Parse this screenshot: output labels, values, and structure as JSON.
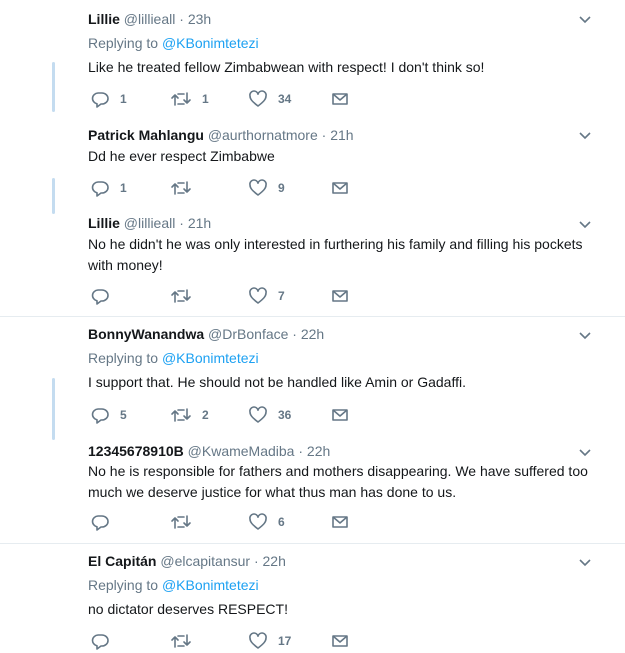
{
  "tweets": [
    {
      "name": "Lillie",
      "handle": "@lillieall",
      "dot": "·",
      "time": "23h",
      "replying_prefix": "Replying to ",
      "replying_handle": "@KBonimtetezi",
      "text": "Like he treated fellow Zimbabwean with respect! I don't think so!",
      "replies": "1",
      "retweets": "1",
      "likes": "34"
    },
    {
      "name": "Patrick Mahlangu",
      "handle": "@aurthornatmore",
      "dot": "·",
      "time": "21h",
      "text": "Dd he ever respect Zimbabwe",
      "replies": "1",
      "retweets": "",
      "likes": "9"
    },
    {
      "name": "Lillie",
      "handle": "@lillieall",
      "dot": "·",
      "time": "21h",
      "text": "No he didn't he was only interested in furthering his family and filling his pockets with money!",
      "replies": "",
      "retweets": "",
      "likes": "7"
    },
    {
      "name": "BonnyWanandwa",
      "handle": "@DrBonface",
      "dot": "·",
      "time": "22h",
      "replying_prefix": "Replying to ",
      "replying_handle": "@KBonimtetezi",
      "text": "I support that. He should not be handled like Amin or Gadaffi.",
      "replies": "5",
      "retweets": "2",
      "likes": "36"
    },
    {
      "name": "12345678910B",
      "handle": "@KwameMadiba",
      "dot": "·",
      "time": "22h",
      "text": "No he is responsible for fathers and mothers disappearing. We have suffered too much we deserve justice for what thus man has done to us.",
      "replies": "",
      "retweets": "",
      "likes": "6"
    },
    {
      "name": "El Capitán",
      "handle": "@elcapitansur",
      "dot": "·",
      "time": "22h",
      "replying_prefix": "Replying to ",
      "replying_handle": "@KBonimtetezi",
      "text": "no dictator deserves RESPECT!",
      "replies": "",
      "retweets": "",
      "likes": "17"
    }
  ],
  "icons": {
    "reply": "reply-icon",
    "retweet": "retweet-icon",
    "like": "heart-icon",
    "message": "envelope-icon",
    "more": "chevron-down-icon"
  },
  "colors": {
    "link": "#1da1f2",
    "muted": "#657786",
    "thread_line": "#c4dcf0",
    "separator": "#e6ecf0"
  }
}
